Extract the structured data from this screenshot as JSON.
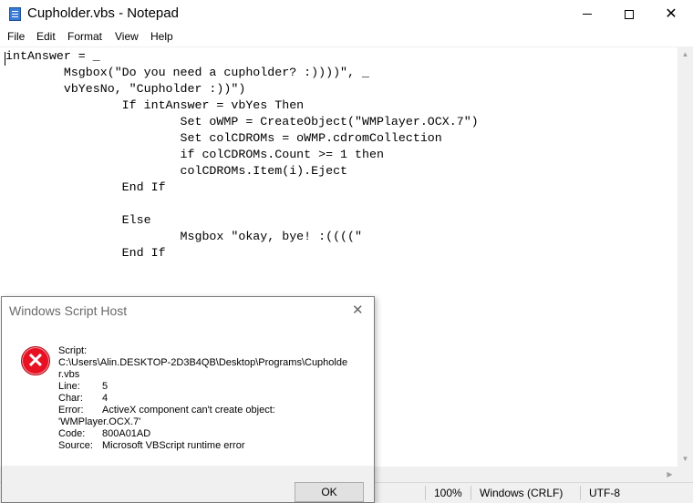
{
  "window": {
    "title": "Cupholder.vbs - Notepad",
    "minimize_glyph": "",
    "close_glyph": "✕"
  },
  "menu": {
    "file": "File",
    "edit": "Edit",
    "format": "Format",
    "view": "View",
    "help": "Help"
  },
  "editor": {
    "content": "intAnswer = _\n        Msgbox(\"Do you need a cupholder? :))))\", _\n        vbYesNo, \"Cupholder :))\")\n                If intAnswer = vbYes Then\n                        Set oWMP = CreateObject(\"WMPlayer.OCX.7\")\n                        Set colCDROMs = oWMP.cdromCollection\n                        if colCDROMs.Count >= 1 then\n                        colCDROMs.Item(i).Eject\n                End If\n\n                Else\n                        Msgbox \"okay, bye! :((((\"\n                End If"
  },
  "statusbar": {
    "zoom": "100%",
    "line_ending": "Windows (CRLF)",
    "encoding": "UTF-8"
  },
  "dialog": {
    "title": "Windows Script Host",
    "close_glyph": "✕",
    "icon": "error-icon",
    "script_label": "Script:",
    "script_path_line1": "C:\\Users\\Alin.DESKTOP-2D3B4QB\\Desktop\\Programs\\Cupholde",
    "script_path_line2": "r.vbs",
    "line_label": "Line:",
    "line_value": "5",
    "char_label": "Char:",
    "char_value": "4",
    "error_label": "Error:",
    "error_value_line1": "ActiveX component can't create object:",
    "error_value_line2": "'WMPlayer.OCX.7'",
    "code_label": "Code:",
    "code_value": "800A01AD",
    "source_label": "Source:",
    "source_value": "Microsoft VBScript runtime error",
    "ok_label": "OK"
  },
  "colors": {
    "error_red": "#e81123",
    "dialog_bg": "#f0f0f0",
    "statusbar_bg": "#f0f0f0"
  }
}
